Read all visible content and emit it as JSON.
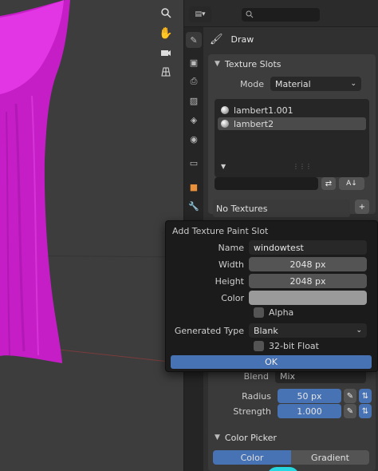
{
  "viewport": {
    "nav_icons": [
      "zoom-icon",
      "hand-icon",
      "camera-icon",
      "grid-icon"
    ]
  },
  "header": {
    "search_placeholder": ""
  },
  "tool": {
    "name": "Draw"
  },
  "texture_slots": {
    "title": "Texture Slots",
    "mode_label": "Mode",
    "mode_value": "Material",
    "slots": [
      "lambert1.001",
      "lambert2"
    ],
    "selected_index": 1,
    "no_textures": "No Textures"
  },
  "popup": {
    "title": "Add Texture Paint Slot",
    "name_label": "Name",
    "name_value": "windowtest",
    "width_label": "Width",
    "width_value": "2048 px",
    "height_label": "Height",
    "height_value": "2048 px",
    "color_label": "Color",
    "color_value": "#9a9a9a",
    "alpha_label": "Alpha",
    "generated_type_label": "Generated Type",
    "generated_type_value": "Blank",
    "float_label": "32-bit Float",
    "ok_label": "OK"
  },
  "brush": {
    "blend_label": "Blend",
    "blend_value": "Mix",
    "radius_label": "Radius",
    "radius_value": "50 px",
    "strength_label": "Strength",
    "strength_value": "1.000"
  },
  "color_picker": {
    "title": "Color Picker",
    "tab_color": "Color",
    "tab_gradient": "Gradient"
  },
  "colors": {
    "accent": "#4772b3",
    "curtain": "#d41fd6"
  }
}
